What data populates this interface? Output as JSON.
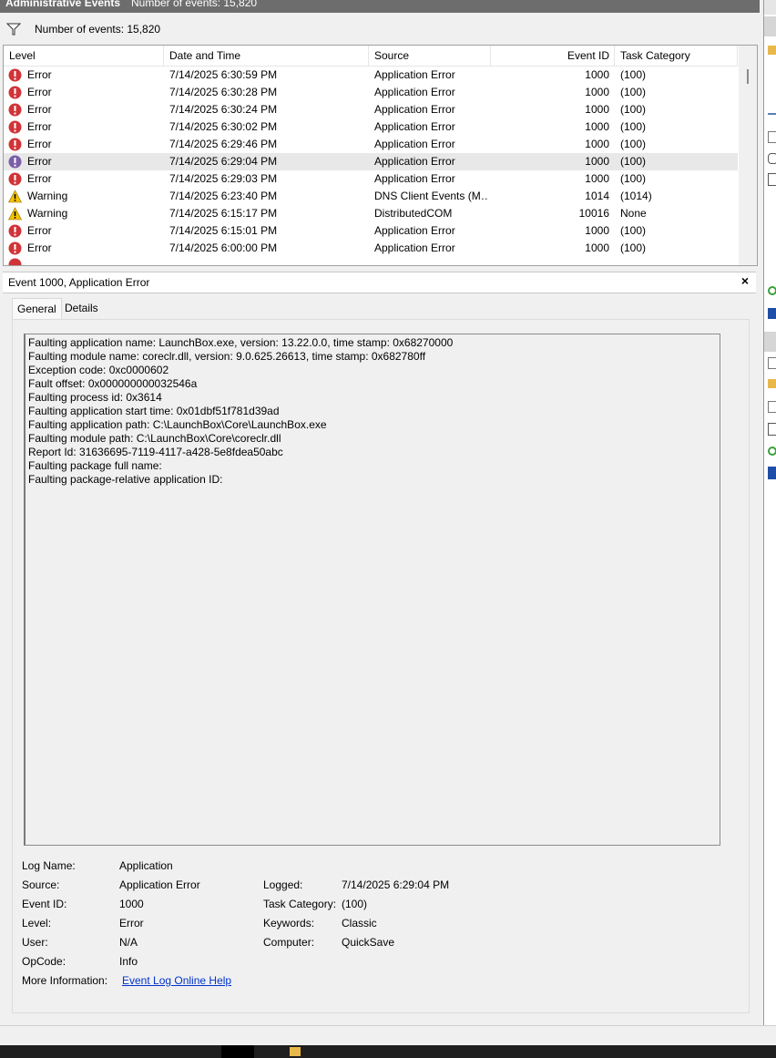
{
  "header": {
    "title": "Administrative Events",
    "count_text": "Number of events: 15,820"
  },
  "filter_bar": {
    "text": "Number of events: 15,820",
    "icon": "filter-funnel-icon"
  },
  "events_table": {
    "columns": [
      "Level",
      "Date and Time",
      "Source",
      "Event ID",
      "Task Category"
    ],
    "rows": [
      {
        "level": "Error",
        "datetime": "7/14/2025 6:30:59 PM",
        "source": "Application Error",
        "event_id": "1000",
        "task": "(100)"
      },
      {
        "level": "Error",
        "datetime": "7/14/2025 6:30:28 PM",
        "source": "Application Error",
        "event_id": "1000",
        "task": "(100)"
      },
      {
        "level": "Error",
        "datetime": "7/14/2025 6:30:24 PM",
        "source": "Application Error",
        "event_id": "1000",
        "task": "(100)"
      },
      {
        "level": "Error",
        "datetime": "7/14/2025 6:30:02 PM",
        "source": "Application Error",
        "event_id": "1000",
        "task": "(100)"
      },
      {
        "level": "Error",
        "datetime": "7/14/2025 6:29:46 PM",
        "source": "Application Error",
        "event_id": "1000",
        "task": "(100)"
      },
      {
        "level": "Error",
        "datetime": "7/14/2025 6:29:04 PM",
        "source": "Application Error",
        "event_id": "1000",
        "task": "(100)",
        "selected": true
      },
      {
        "level": "Error",
        "datetime": "7/14/2025 6:29:03 PM",
        "source": "Application Error",
        "event_id": "1000",
        "task": "(100)"
      },
      {
        "level": "Warning",
        "datetime": "7/14/2025 6:23:40 PM",
        "source": "DNS Client Events (M…",
        "event_id": "1014",
        "task": "(1014)"
      },
      {
        "level": "Warning",
        "datetime": "7/14/2025 6:15:17 PM",
        "source": "DistributedCOM",
        "event_id": "10016",
        "task": "None"
      },
      {
        "level": "Error",
        "datetime": "7/14/2025 6:15:01 PM",
        "source": "Application Error",
        "event_id": "1000",
        "task": "(100)"
      },
      {
        "level": "Error",
        "datetime": "7/14/2025 6:00:00 PM",
        "source": "Application Error",
        "event_id": "1000",
        "task": "(100)"
      }
    ]
  },
  "detail": {
    "title": "Event 1000, Application Error",
    "close_label": "×",
    "tabs": [
      "General",
      "Details"
    ],
    "description_lines": [
      "Faulting application name: LaunchBox.exe, version: 13.22.0.0, time stamp: 0x68270000",
      "Faulting module name: coreclr.dll, version: 9.0.625.26613, time stamp: 0x682780ff",
      "Exception code: 0xc0000602",
      "Fault offset: 0x000000000032546a",
      "Faulting process id: 0x3614",
      "Faulting application start time: 0x01dbf51f781d39ad",
      "Faulting application path: C:\\LaunchBox\\Core\\LaunchBox.exe",
      "Faulting module path: C:\\LaunchBox\\Core\\coreclr.dll",
      "Report Id: 31636695-7119-4117-a428-5e8fdea50abc",
      "Faulting package full name: ",
      "Faulting package-relative application ID: "
    ],
    "properties": {
      "log_name_label": "Log Name:",
      "log_name": "Application",
      "source_label": "Source:",
      "source": "Application Error",
      "logged_label": "Logged:",
      "logged": "7/14/2025 6:29:04 PM",
      "event_id_label": "Event ID:",
      "event_id": "1000",
      "task_category_label": "Task Category:",
      "task_category": "(100)",
      "level_label": "Level:",
      "level": "Error",
      "keywords_label": "Keywords:",
      "keywords": "Classic",
      "user_label": "User:",
      "user": "N/A",
      "computer_label": "Computer:",
      "computer": "QuickSave",
      "opcode_label": "OpCode:",
      "opcode": "Info",
      "more_info_label": "More Information:",
      "more_info_link": "Event Log Online Help"
    }
  },
  "colors": {
    "error_red": "#d13438",
    "warning_yellow": "#f5c400",
    "link_blue": "#0033cc",
    "action_blue": "#1f4ea8",
    "selected_row": "#e8e8e8"
  }
}
